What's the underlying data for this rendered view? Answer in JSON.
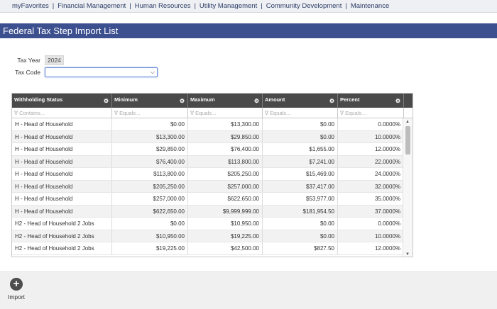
{
  "nav": {
    "items": [
      "myFavorites",
      "Financial Management",
      "Human Resources",
      "Utility Management",
      "Community Development",
      "Maintenance"
    ]
  },
  "page": {
    "title": "Federal Tax Step Import List"
  },
  "form": {
    "tax_year_label": "Tax Year",
    "tax_year_value": "2024",
    "tax_code_label": "Tax Code",
    "tax_code_value": ""
  },
  "grid": {
    "columns": [
      "Withholding Status",
      "Minimum",
      "Maximum",
      "Amount",
      "Percent"
    ],
    "filters": [
      "Contains...",
      "Equals...",
      "Equals...",
      "Equals...",
      "Equals..."
    ],
    "rows": [
      [
        "H - Head of Household",
        "$0.00",
        "$13,300.00",
        "$0.00",
        "0.0000%"
      ],
      [
        "H - Head of Household",
        "$13,300.00",
        "$29,850.00",
        "$0.00",
        "10.0000%"
      ],
      [
        "H - Head of Household",
        "$29,850.00",
        "$76,400.00",
        "$1,655.00",
        "12.0000%"
      ],
      [
        "H - Head of Household",
        "$76,400.00",
        "$113,800.00",
        "$7,241.00",
        "22.0000%"
      ],
      [
        "H - Head of Household",
        "$113,800.00",
        "$205,250.00",
        "$15,469.00",
        "24.0000%"
      ],
      [
        "H - Head of Household",
        "$205,250.00",
        "$257,000.00",
        "$37,417.00",
        "32.0000%"
      ],
      [
        "H - Head of Household",
        "$257,000.00",
        "$622,650.00",
        "$53,977.00",
        "35.0000%"
      ],
      [
        "H - Head of Household",
        "$622,650.00",
        "$9,999,999.00",
        "$181,954.50",
        "37.0000%"
      ],
      [
        "H2 - Head of Household 2 Jobs",
        "$0.00",
        "$10,950.00",
        "$0.00",
        "0.0000%"
      ],
      [
        "H2 - Head of Household 2 Jobs",
        "$10,950.00",
        "$19,225.00",
        "$0.00",
        "10.0000%"
      ],
      [
        "H2 - Head of Household 2 Jobs",
        "$19,225.00",
        "$42,500.00",
        "$827.50",
        "12.0000%"
      ]
    ]
  },
  "footer": {
    "import_label": "Import"
  }
}
